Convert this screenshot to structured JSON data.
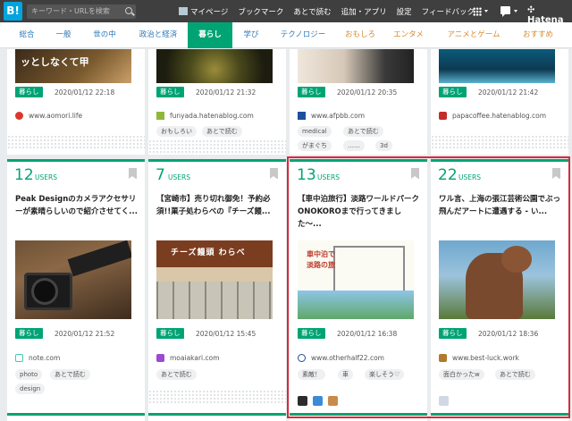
{
  "topbar": {
    "logo": "B!",
    "search_placeholder": "キーワード・URLを検索",
    "nav": [
      "マイページ",
      "ブックマーク",
      "あとで読む",
      "追加・アプリ",
      "設定",
      "フィードバック"
    ],
    "brand": "Hatena"
  },
  "categories": [
    {
      "label": "総合",
      "active": false
    },
    {
      "label": "一般",
      "active": false
    },
    {
      "label": "世の中",
      "active": false
    },
    {
      "label": "政治と経済",
      "active": false
    },
    {
      "label": "暮らし",
      "active": true
    },
    {
      "label": "学び",
      "active": false
    },
    {
      "label": "テクノロジー",
      "active": false
    },
    {
      "label": "おもしろ",
      "active": false
    },
    {
      "label": "エンタメ",
      "active": false
    },
    {
      "label": "アニメとゲーム",
      "active": false
    },
    {
      "label": "おすすめ",
      "active": false
    }
  ],
  "top_cards": [
    {
      "thumb_text": "ッとしなくて甲",
      "tag": "暮らし",
      "date": "2020/01/12 22:18",
      "domain": "www.aomori.life",
      "chips": []
    },
    {
      "tag": "暮らし",
      "date": "2020/01/12 21:32",
      "domain": "funyada.hatenablog.com",
      "chips": [
        "おもしろい",
        "あとで読む"
      ]
    },
    {
      "tag": "暮らし",
      "date": "2020/01/12 20:35",
      "domain": "www.afpbb.com",
      "chips": [
        "medical",
        "あとで読む",
        "がまぐち",
        "……",
        "3d"
      ]
    },
    {
      "tag": "暮らし",
      "date": "2020/01/12 21:42",
      "domain": "papacoffee.hatenablog.com",
      "chips": []
    }
  ],
  "cards": [
    {
      "users": "12",
      "users_label": "USERS",
      "title": "Peak Designのカメラアクセサリーが素晴らしいので紹介させてく...",
      "tag": "暮らし",
      "date": "2020/01/12 21:52",
      "domain": "note.com",
      "chips": [
        "photo",
        "あとで読む",
        "design"
      ]
    },
    {
      "users": "7",
      "users_label": "USERS",
      "title": "【宮崎市】売り切れ御免！予約必須!!菓子処わらべの『チーズ饅...",
      "thumb_text": "チーズ饅頭 わらべ",
      "tag": "暮らし",
      "date": "2020/01/12 15:45",
      "domain": "moaiakari.com",
      "chips": [
        "あとで読む"
      ]
    },
    {
      "users": "13",
      "users_label": "USERS",
      "title": "【車中泊旅行】淡路ワールドパークONOKOROまで行ってきました〜...",
      "thumb_text": "車中泊で 淡路の旅",
      "tag": "暮らし",
      "date": "2020/01/12 16:38",
      "domain": "www.otherhalf22.com",
      "chips": [
        "素敵！",
        "車",
        "楽しそう♡"
      ]
    },
    {
      "users": "22",
      "users_label": "USERS",
      "title": "ワル言、上海の張江芸術公園でぶっ飛んだアートに遭遇する - い...",
      "tag": "暮らし",
      "date": "2020/01/12 18:36",
      "domain": "www.best-luck.work",
      "chips": [
        "面白かったw",
        "あとで読む"
      ]
    }
  ],
  "colors": {
    "accent": "#00a474",
    "link": "#2e7ab8",
    "topbar": "#3f3f3f",
    "highlight": "#d62b3b"
  }
}
